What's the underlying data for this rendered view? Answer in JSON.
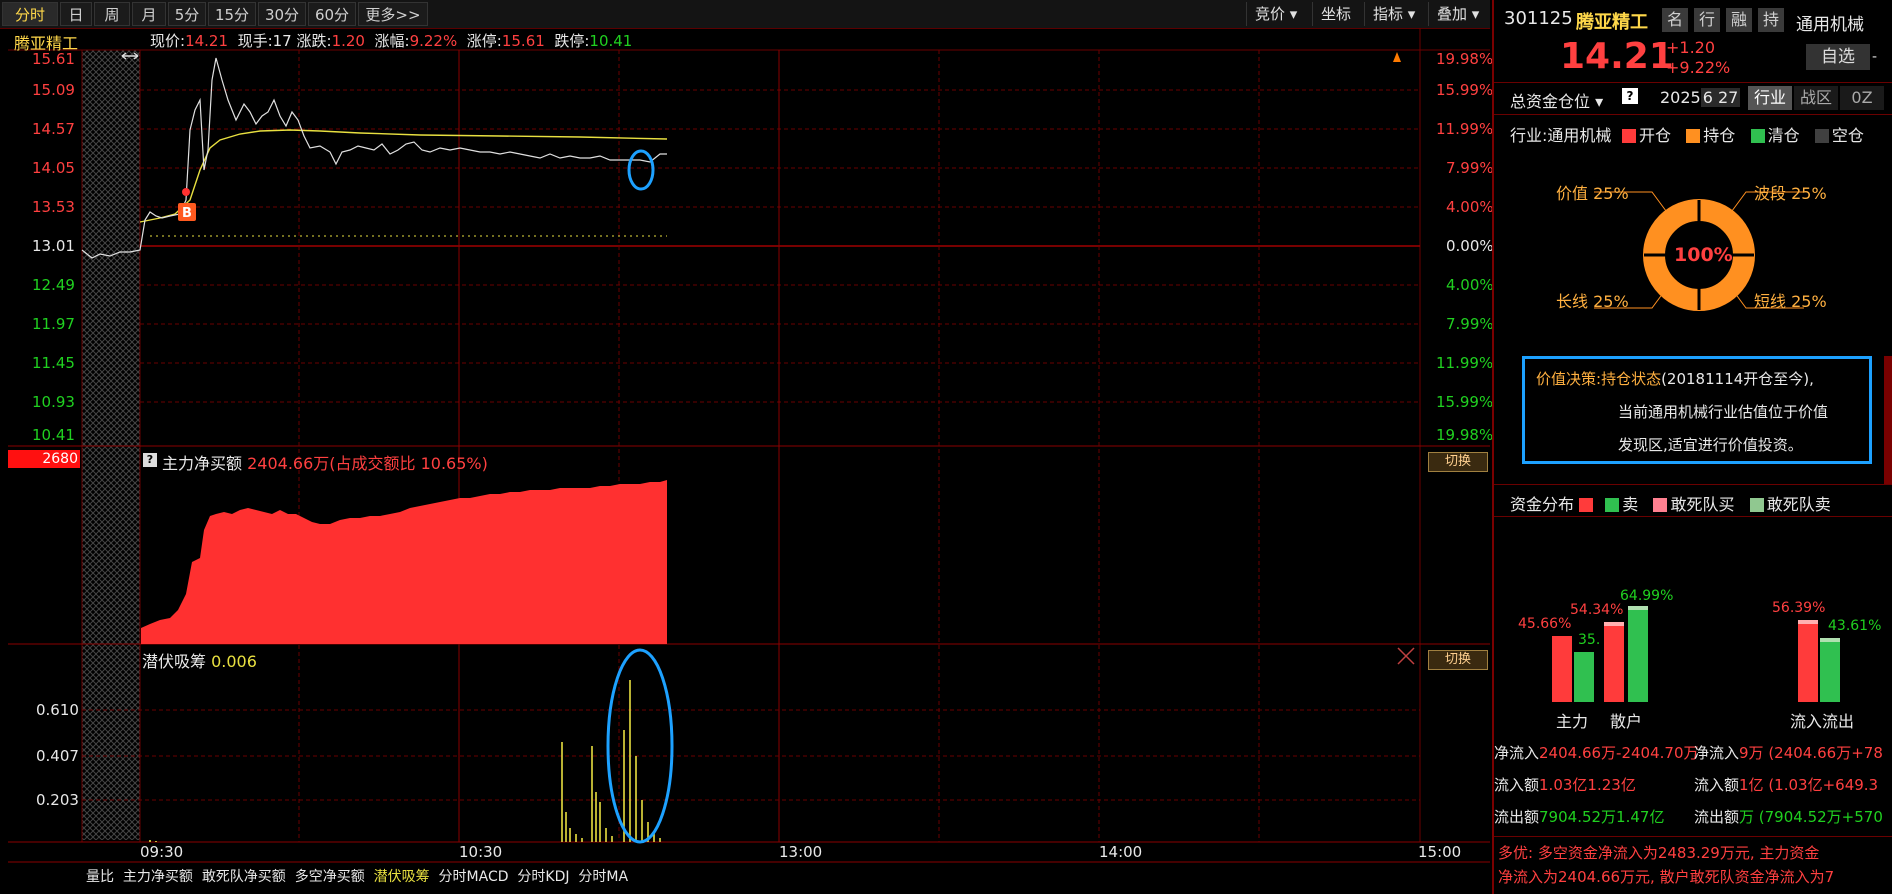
{
  "toolbar": {
    "tabs": [
      "分时",
      "日",
      "周",
      "月",
      "5分",
      "15分",
      "30分",
      "60分",
      "更多>>"
    ],
    "active_tab": "分时",
    "dropdowns": [
      "竞价",
      "坐标",
      "指标",
      "叠加"
    ]
  },
  "quote_bar": {
    "name": "腾亚精工",
    "price_label": "现价:",
    "price": "14.21",
    "hand_label": "现手:",
    "hand": "17",
    "change_label": "涨跌:",
    "change": "1.20",
    "pct_label": "涨幅:",
    "pct": "9.22%",
    "limit_up_label": "涨停:",
    "limit_up": "15.61",
    "limit_down_label": "跌停:",
    "limit_down": "10.41"
  },
  "price_axis": {
    "left": [
      "15.61",
      "15.09",
      "14.57",
      "14.05",
      "13.53",
      "13.01",
      "12.49",
      "11.97",
      "11.45",
      "10.93",
      "10.41"
    ],
    "right": [
      "19.98%",
      "15.99%",
      "11.99%",
      "7.99%",
      "4.00%",
      "0.00%",
      "4.00%",
      "7.99%",
      "11.99%",
      "15.99%",
      "19.98%"
    ]
  },
  "main_net": {
    "badge": "2680",
    "title": "主力净买额",
    "value": "2404.66万(占成交额比 10.65%)",
    "switch": "切换"
  },
  "qianfu": {
    "title": "潜伏吸筹",
    "value": "0.006",
    "axis": [
      "0.610",
      "0.407",
      "0.203"
    ],
    "switch": "切换"
  },
  "time_axis": [
    "09:30",
    "10:30",
    "13:00",
    "14:00",
    "15:00"
  ],
  "bottom_tabs": [
    "量比",
    "主力净买额",
    "敢死队净买额",
    "多空净买额",
    "潜伏吸筹",
    "分时MACD",
    "分时KDJ",
    "分时MA"
  ],
  "active_bottom_tab": "潜伏吸筹",
  "buy_marker": "B",
  "right": {
    "code": "301125",
    "name": "腾亚精工",
    "tags": [
      "名",
      "行",
      "融",
      "持"
    ],
    "industry": "通用机械",
    "price": "14.21",
    "change": "+1.20",
    "pct": "+9.22%",
    "zixuan": "自选",
    "zixuan_minus": "-",
    "position_label": "总资金仓位",
    "help": "?",
    "date": "2025",
    "date_overlay": "6 27",
    "subtabs": [
      "行业",
      "战区",
      "0Z"
    ],
    "industry_line": "行业:通用机械",
    "legend": [
      "开仓",
      "持仓",
      "清仓",
      "空仓"
    ],
    "legend_colors": [
      "#ff3b3b",
      "#ff9020",
      "#30c050",
      "#404040"
    ],
    "donut_center": "100%",
    "donut_labels": {
      "tl": "价值 25%",
      "tr": "波段 25%",
      "bl": "长线 25%",
      "br": "短线 25%"
    },
    "decision_title": "价值决策:",
    "decision_status": "持仓状态",
    "decision_text1": "(20181114开仓至今),",
    "decision_text2": "当前通用机械行业估值位于价值",
    "decision_text3": "发现区,适宜进行价值投资。",
    "fund_label": "资金分布",
    "fund_legend": [
      "卖",
      "敢死队买",
      "敢死队卖"
    ],
    "bars": {
      "main_in": "45.66%",
      "main_out": "35.",
      "retail_in": "54.34%",
      "retail_out": "64.99%",
      "flow_in": "56.39%",
      "flow_out": "43.61%",
      "labels": [
        "主力",
        "散户",
        "流入流出"
      ]
    },
    "net_row": [
      "净流入",
      "2404.66万",
      "-2404.70万",
      "净流入",
      "9万 (2404.66万+78"
    ],
    "in_row": [
      "流入额",
      "1.03亿",
      "1.23亿",
      "流入额",
      "1亿 (1.03亿+649.3"
    ],
    "out_row": [
      "流出额",
      "7904.52万",
      "1.47亿",
      "流出额",
      "万 (7904.52万+570"
    ],
    "summary1": "多优: 多空资金净流入为2483.29万元, 主力资金",
    "summary2": "净流入为2404.66万元, 散户敢死队资金净流入为7"
  }
}
